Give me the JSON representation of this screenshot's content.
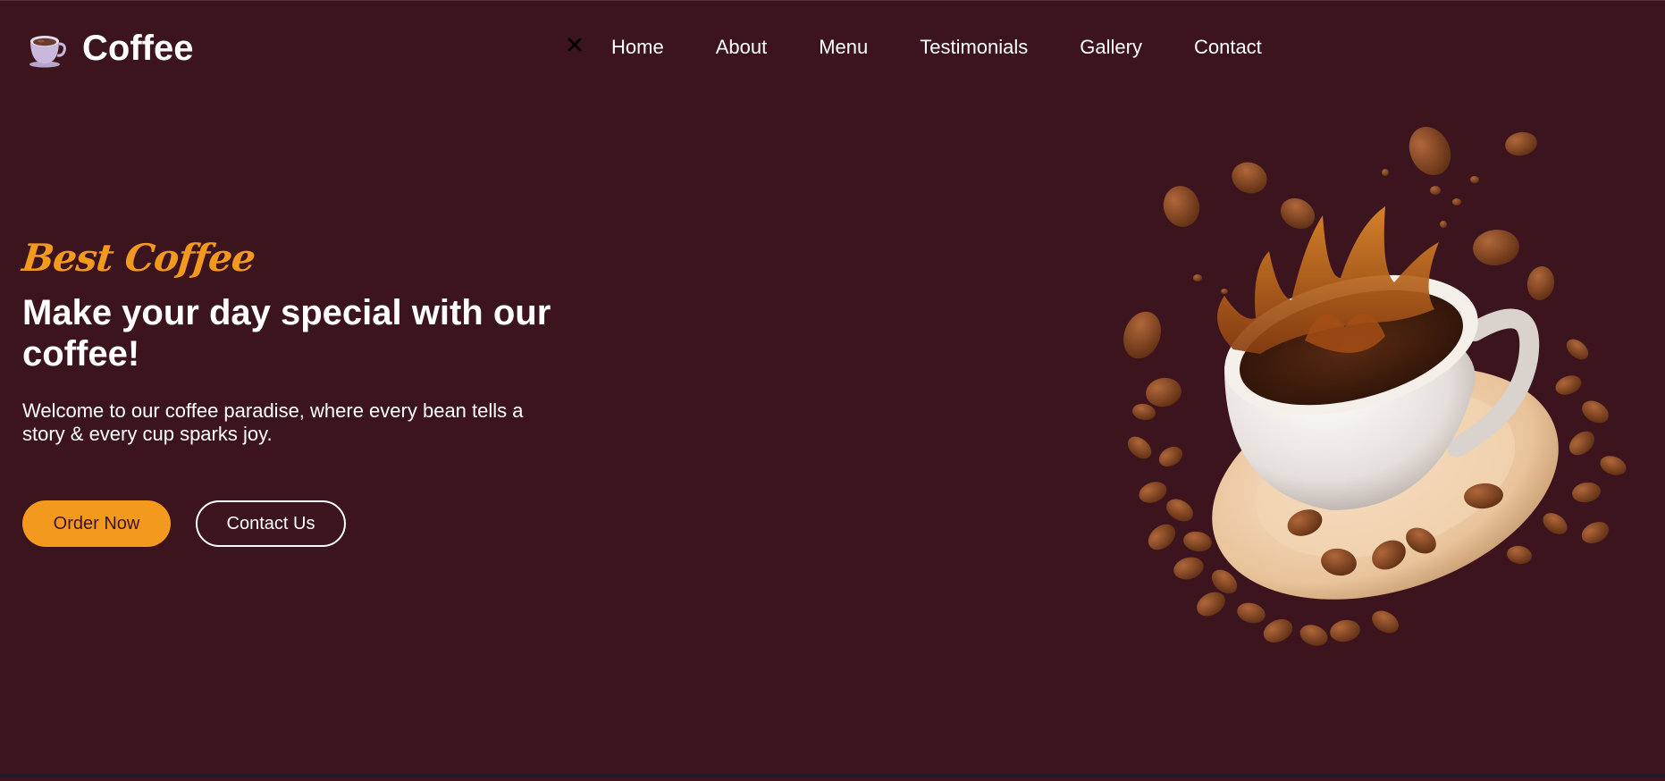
{
  "brand": {
    "name": "Coffee",
    "logo_icon": "coffee-cup-icon"
  },
  "nav": {
    "close_icon": "close-icon",
    "items": [
      {
        "label": "Home"
      },
      {
        "label": "About"
      },
      {
        "label": "Menu"
      },
      {
        "label": "Testimonials"
      },
      {
        "label": "Gallery"
      },
      {
        "label": "Contact"
      }
    ]
  },
  "hero": {
    "subtitle": "Best Coffee",
    "headline": "Make your day special with our coffee!",
    "description": "Welcome to our coffee paradise, where every bean tells a story & every cup sparks joy.",
    "primary_button": "Order Now",
    "secondary_button": "Contact Us",
    "image": "coffee-splash-cup-image"
  },
  "colors": {
    "background": "#3b141e",
    "accent": "#f39a1e",
    "text": "#ffffff"
  }
}
